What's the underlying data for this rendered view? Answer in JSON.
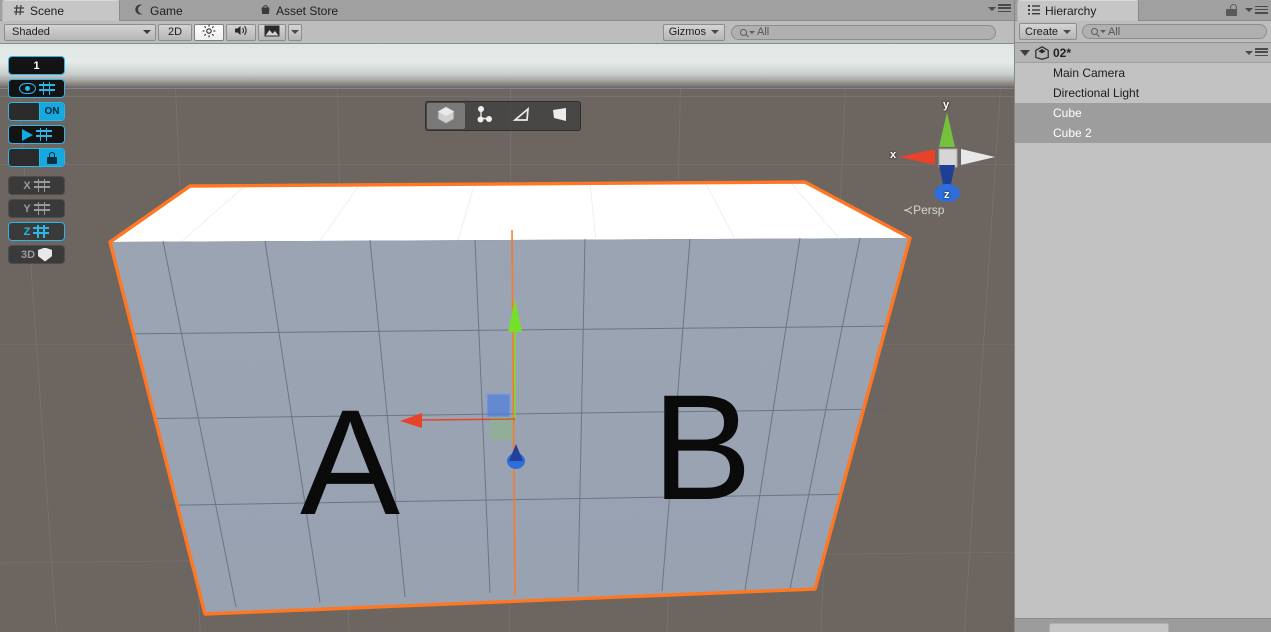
{
  "scene_panel": {
    "tabs": [
      {
        "label": "Scene",
        "icon": "grid-hash-icon",
        "active": true
      },
      {
        "label": "Game",
        "icon": "gamepad-icon",
        "active": false
      },
      {
        "label": "Asset Store",
        "icon": "shopping-bag-icon",
        "active": false
      }
    ],
    "toolbar": {
      "draw_mode": "Shaded",
      "toggle_2d": "2D",
      "lighting_icon": "sun-icon",
      "audio_icon": "speaker-icon",
      "effects_icon": "image-icon",
      "gizmos_label": "Gizmos",
      "search_placeholder": "All",
      "search_value": "All"
    },
    "progrids": {
      "snap_value": "1",
      "buttons": [
        {
          "name": "snap-value",
          "label": "1",
          "state": "active"
        },
        {
          "name": "toggle-grid-visibility",
          "label": "",
          "state": "active"
        },
        {
          "name": "snap-enabled",
          "label": "ON",
          "state": "active"
        },
        {
          "name": "push-to-grid",
          "label": "",
          "state": "active"
        },
        {
          "name": "lock-grid",
          "label": "",
          "state": "active"
        },
        {
          "name": "axis-x",
          "label": "X",
          "state": "dim"
        },
        {
          "name": "axis-y",
          "label": "Y",
          "state": "dim"
        },
        {
          "name": "axis-z",
          "label": "Z",
          "state": "active"
        },
        {
          "name": "toggle-3d",
          "label": "3D",
          "state": "dim"
        }
      ]
    },
    "mode_toolbar": [
      {
        "name": "object-mode",
        "icon": "cube-icon",
        "selected": true
      },
      {
        "name": "vertex-mode",
        "icon": "vertex-icon",
        "selected": false
      },
      {
        "name": "edge-mode",
        "icon": "edge-icon",
        "selected": false
      },
      {
        "name": "face-mode",
        "icon": "face-icon",
        "selected": false
      }
    ],
    "view_gizmo": {
      "axis_x": "x",
      "axis_y": "y",
      "axis_z": "z",
      "projection": "Persp",
      "projection_prefix": "≺"
    },
    "objects": [
      {
        "label": "A",
        "name": "cube-a"
      },
      {
        "label": "B",
        "name": "cube-b"
      }
    ],
    "colors": {
      "selection_outline": "#ff7722",
      "axis_x": "#e8432a",
      "axis_y": "#74e02a",
      "axis_z": "#2d59c8",
      "progrids_accent": "#2fb6e8",
      "cube_top": "#ffffff",
      "cube_front": "#9aa5b4",
      "ground": "#6c6560",
      "sky": "#dfe6e4"
    }
  },
  "hierarchy_panel": {
    "tab_label": "Hierarchy",
    "tab_icon": "hierarchy-list-icon",
    "lock_icon": "unlock-icon",
    "menu_icon": "options-menu-icon",
    "create_button": "Create",
    "search_placeholder": "All",
    "search_value": "All",
    "scene_name": "02*",
    "items": [
      {
        "label": "Main Camera",
        "selected": false,
        "indent": 1
      },
      {
        "label": "Directional Light",
        "selected": false,
        "indent": 1
      },
      {
        "label": "Cube",
        "selected": true,
        "indent": 1
      },
      {
        "label": "Cube 2",
        "selected": true,
        "indent": 1
      }
    ]
  }
}
